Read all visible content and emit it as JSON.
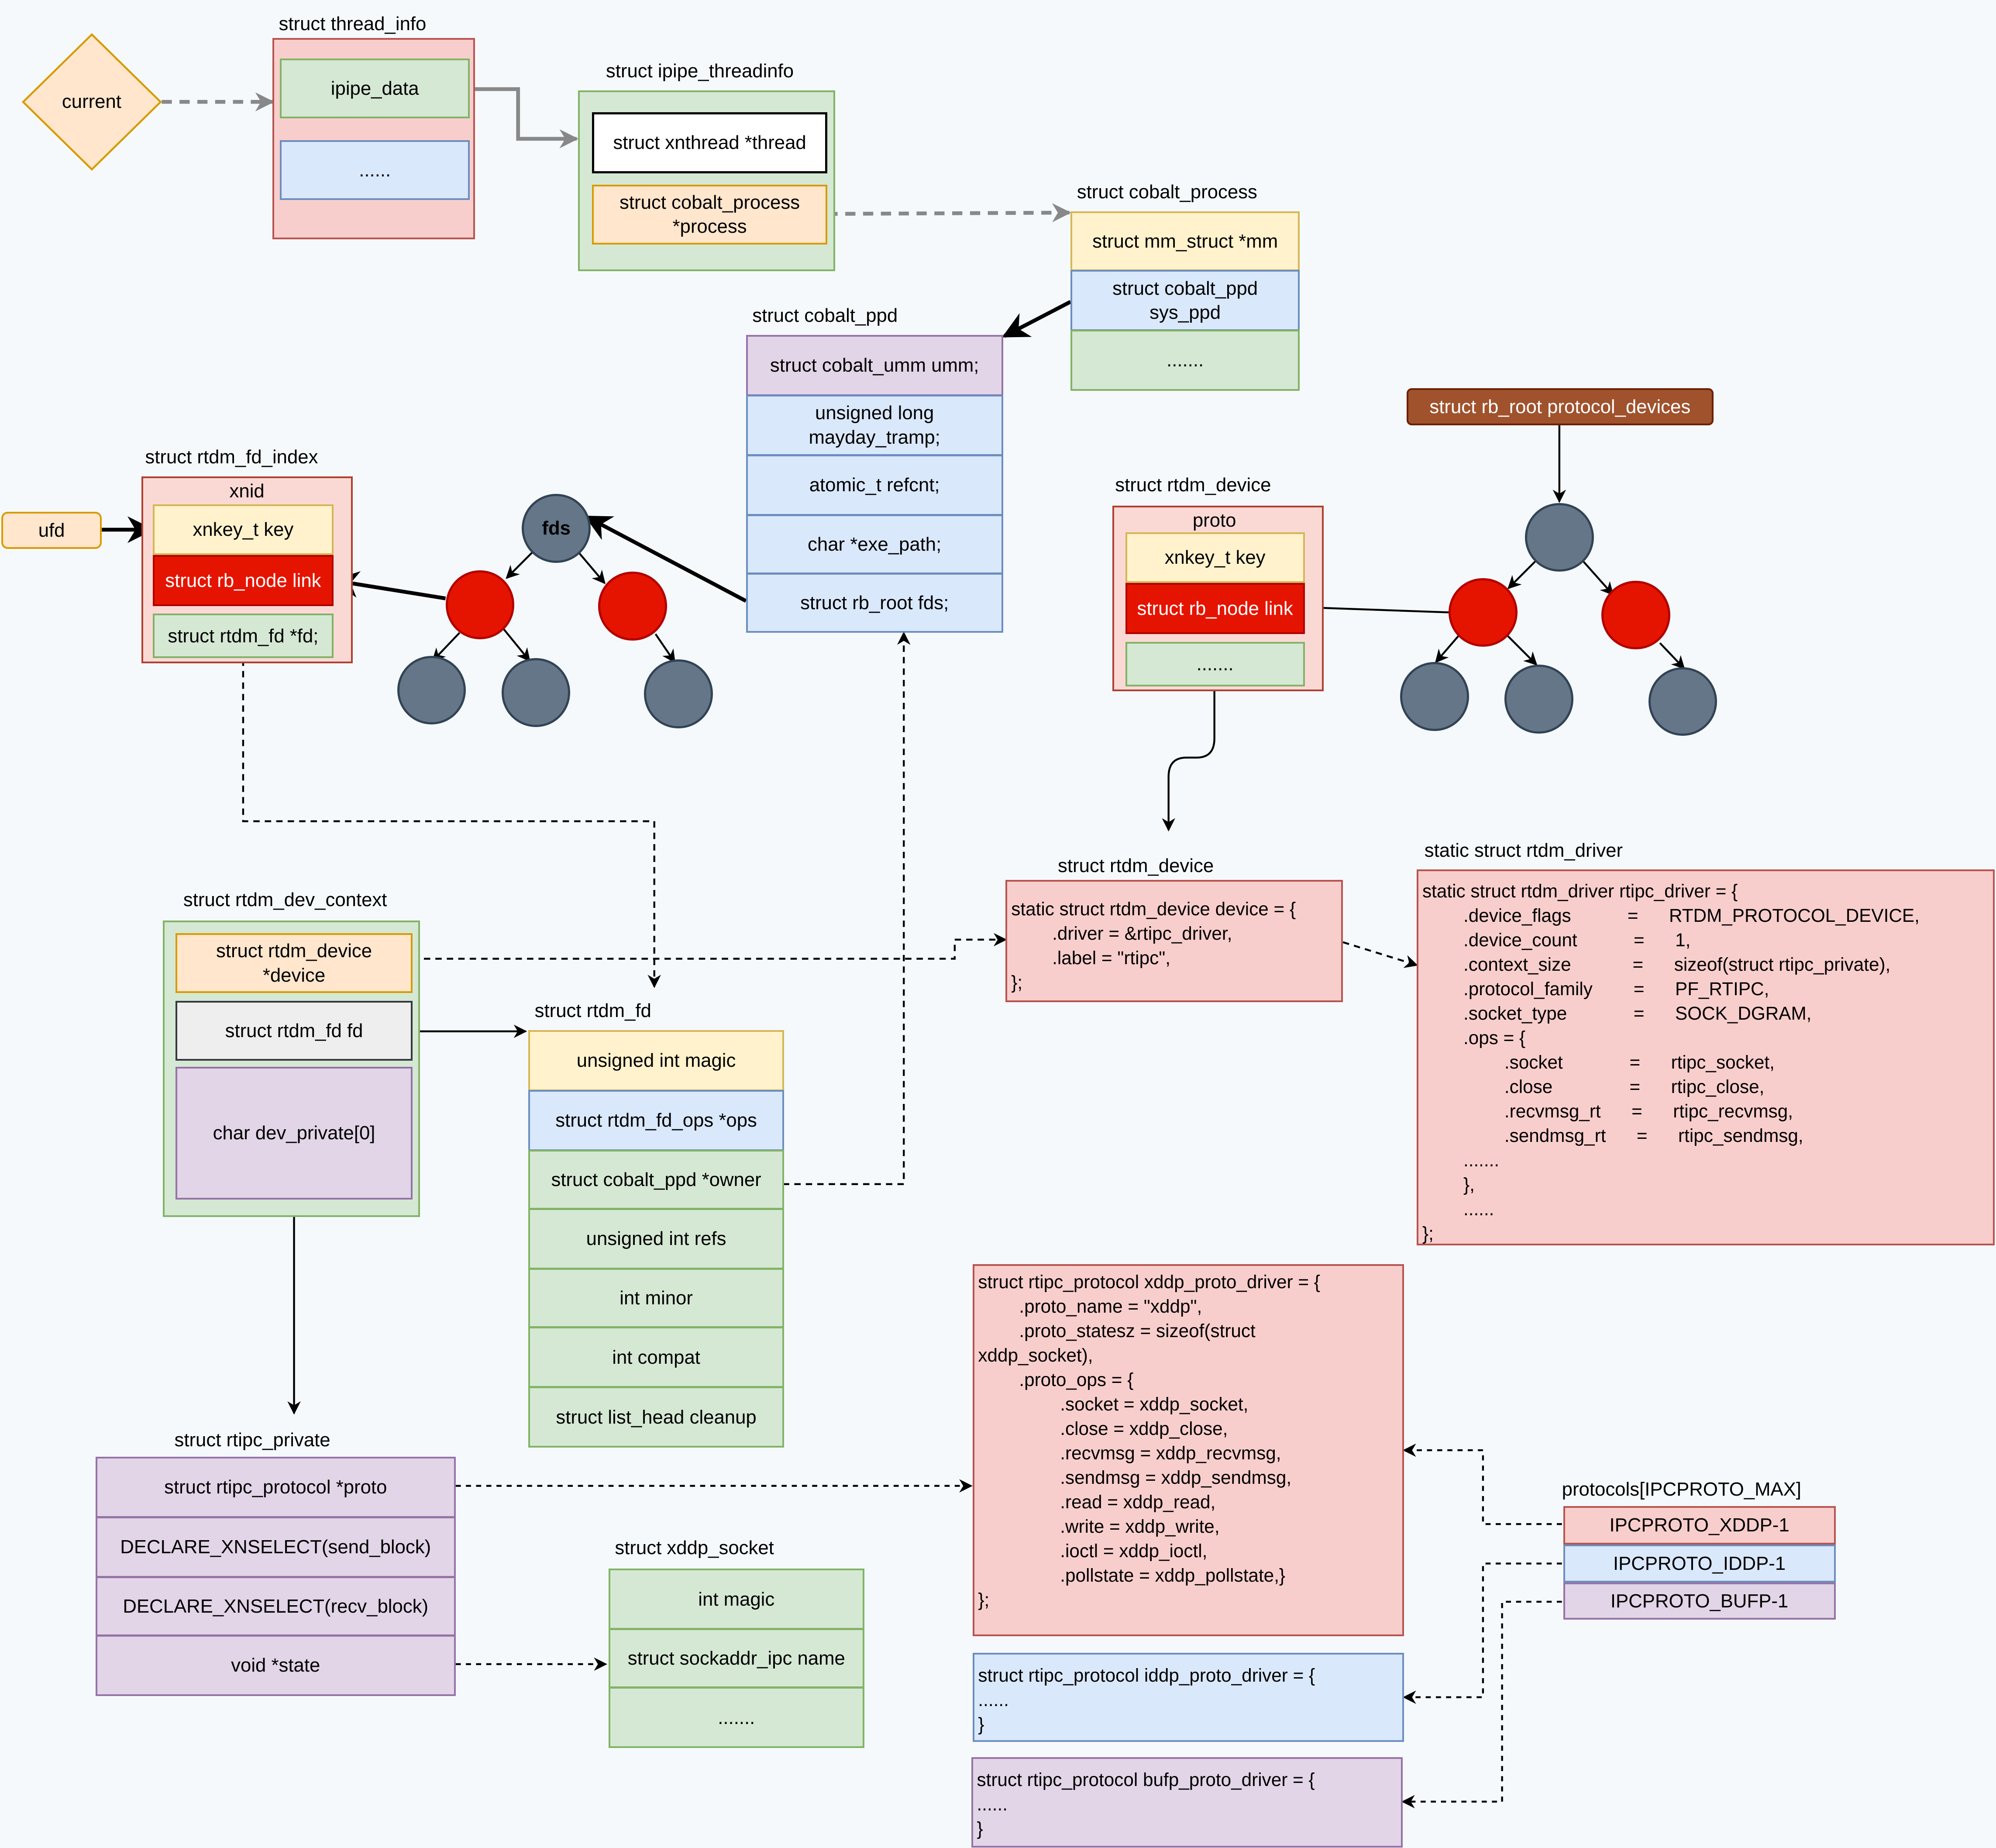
{
  "current": {
    "label": "current"
  },
  "thread_info": {
    "title": "struct thread_info",
    "fields": [
      "ipipe_data",
      "......"
    ]
  },
  "ipipe_threadinfo": {
    "title": "struct ipipe_threadinfo",
    "fields": [
      "struct xnthread *thread",
      "struct cobalt_process\n*process"
    ]
  },
  "cobalt_process": {
    "title": "struct cobalt_process",
    "fields": [
      "struct mm_struct *mm",
      "struct cobalt_ppd\nsys_ppd",
      "......."
    ]
  },
  "cobalt_ppd": {
    "title": "struct cobalt_ppd",
    "fields": [
      "struct cobalt_umm umm;",
      "unsigned long\nmayday_tramp;",
      "atomic_t refcnt;",
      "char *exe_path;",
      "struct rb_root fds;"
    ]
  },
  "rtdm_fd_index": {
    "title": "struct rtdm_fd_index",
    "group": "xnid",
    "fields": [
      "xnkey_t key",
      "struct rb_node link",
      "struct rtdm_fd *fd;"
    ]
  },
  "ufd": {
    "label": "ufd"
  },
  "fds_tree": {
    "root_label": "fds"
  },
  "protocol_devices": {
    "label": "struct rb_root protocol_devices"
  },
  "rtdm_device_proto": {
    "title": "struct rtdm_device",
    "group": "proto",
    "fields": [
      "xnkey_t key",
      "struct rb_node link",
      "......."
    ]
  },
  "rtdm_device_def": {
    "title": "struct rtdm_device",
    "code": "static struct rtdm_device device = {\n        .driver = &rtipc_driver,\n        .label = \"rtipc\",\n};"
  },
  "rtdm_driver": {
    "title": "static struct rtdm_driver",
    "code": "static struct rtdm_driver rtipc_driver = {\n        .device_flags           =      RTDM_PROTOCOL_DEVICE,\n        .device_count           =      1,\n        .context_size            =      sizeof(struct rtipc_private),\n        .protocol_family        =      PF_RTIPC,\n        .socket_type             =      SOCK_DGRAM,\n        .ops = {\n                .socket             =      rtipc_socket,\n                .close               =      rtipc_close,\n                .recvmsg_rt      =      rtipc_recvmsg,\n                .sendmsg_rt      =      rtipc_sendmsg,\n        .......\n        },\n        ......\n};"
  },
  "rtdm_dev_context": {
    "title": "struct rtdm_dev_context",
    "fields": [
      "struct rtdm_device\n*device",
      "struct rtdm_fd fd",
      "char dev_private[0]"
    ]
  },
  "rtdm_fd": {
    "title": "struct rtdm_fd",
    "fields": [
      "unsigned int magic",
      "struct rtdm_fd_ops *ops",
      "struct cobalt_ppd *owner",
      "unsigned int refs",
      "int minor",
      "int compat",
      "struct list_head cleanup"
    ]
  },
  "rtipc_private": {
    "title": "struct rtipc_private",
    "fields": [
      "struct rtipc_protocol *proto",
      "DECLARE_XNSELECT(send_block)",
      "DECLARE_XNSELECT(recv_block)",
      "void *state"
    ]
  },
  "xddp_socket": {
    "title": "struct xddp_socket",
    "fields": [
      "int magic",
      "struct sockaddr_ipc name",
      "......."
    ]
  },
  "xddp_proto_driver": {
    "code": "struct rtipc_protocol xddp_proto_driver = {\n        .proto_name = \"xddp\",\n        .proto_statesz = sizeof(struct\nxddp_socket),\n        .proto_ops = {\n                .socket = xddp_socket,\n                .close = xddp_close,\n                .recvmsg = xddp_recvmsg,\n                .sendmsg = xddp_sendmsg,\n                .read = xddp_read,\n                .write = xddp_write,\n                .ioctl = xddp_ioctl,\n                .pollstate = xddp_pollstate,}\n};"
  },
  "iddp_proto_driver": {
    "code": "struct rtipc_protocol iddp_proto_driver = {\n......\n}"
  },
  "bufp_proto_driver": {
    "code": "struct rtipc_protocol bufp_proto_driver = {\n......\n}"
  },
  "protocols": {
    "title": "protocols[IPCPROTO_MAX]",
    "entries": [
      "IPCPROTO_XDDP-1",
      "IPCPROTO_IDDP-1",
      "IPCPROTO_BUFP-1"
    ]
  }
}
